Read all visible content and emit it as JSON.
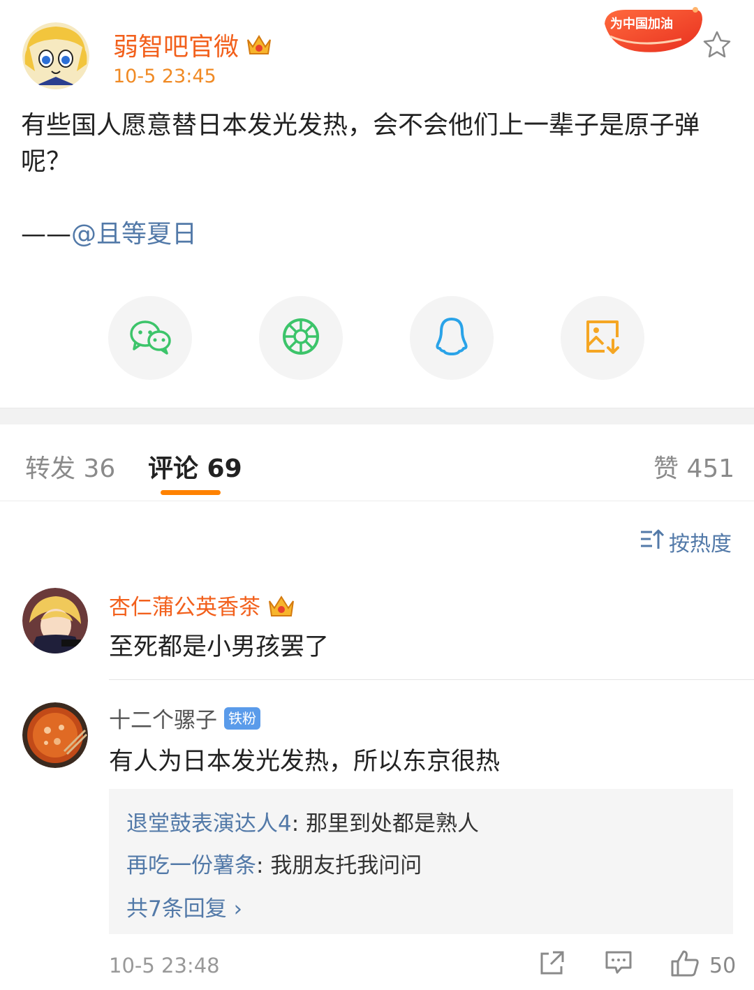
{
  "post": {
    "author": "弱智吧官微",
    "time": "10-5 23:45",
    "badge_text": "为中国加油",
    "text": "有些国人愿意替日本发光发热，会不会他们上一辈子是原子弹呢？",
    "signature_prefix": "——",
    "signature_mention": "@且等夏日"
  },
  "share": [
    "wechat-icon",
    "moments-icon",
    "qq-icon",
    "save-image-icon"
  ],
  "tabs": {
    "repost": "转发 36",
    "comments": "评论 69",
    "likes": "赞 451"
  },
  "sort_label": "按热度",
  "comments": [
    {
      "name": "杏仁蒲公英香茶",
      "text": "至死都是小男孩罢了"
    },
    {
      "name": "十二个骡子",
      "badge": "铁粉",
      "text": "有人为日本发光发热，所以东京很热",
      "replies": [
        {
          "who": "退堂鼓表演达人4",
          "sep": ": ",
          "text": "那里到处都是熟人"
        },
        {
          "who": "再吃一份薯条",
          "sep": ": ",
          "text": "我朋友托我问问"
        }
      ],
      "more_replies": "共7条回复 ›",
      "time": "10-5 23:48",
      "likes": "50"
    }
  ],
  "colors": {
    "accent_orange": "#ff8200",
    "author_orange": "#f2601c",
    "link_blue": "#5279a8"
  }
}
